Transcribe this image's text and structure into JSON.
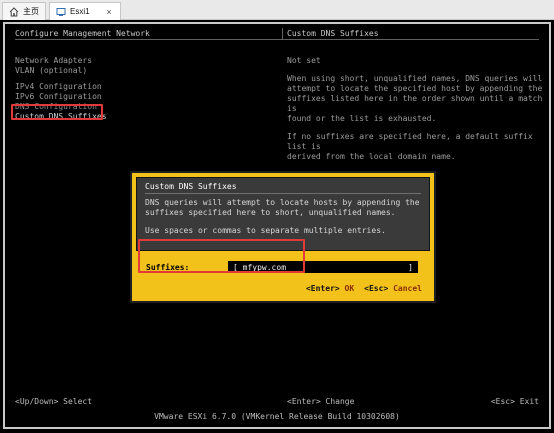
{
  "tabs": [
    {
      "label": "主页",
      "icon": "home-icon",
      "active": false
    },
    {
      "label": "Esxi1",
      "icon": "vm-console-icon",
      "active": true,
      "close": "×"
    }
  ],
  "console": {
    "left_header": "Configure Management Network",
    "right_header": "Custom DNS Suffixes",
    "menu_items": [
      "Network Adapters",
      "VLAN (optional)",
      "",
      "IPv4 Configuration",
      "IPv6 Configuration",
      "DNS Configuration",
      "Custom DNS Suffixes"
    ],
    "right_description": {
      "line1": "Not set",
      "para1": [
        "When using short, unqualified names, DNS queries will",
        "attempt to locate the specified host by appending the",
        "suffixes listed here in the order shown until a match is",
        "found or the list is exhausted."
      ],
      "para2": [
        "If no suffixes are specified here, a default suffix list is",
        "derived from the local domain name."
      ]
    },
    "dialog": {
      "title": "Custom DNS Suffixes",
      "text1": [
        "DNS queries will attempt to locate hosts by appending the",
        "suffixes specified here to short, unqualified names."
      ],
      "text2": [
        "Use spaces or commas to separate multiple entries."
      ],
      "field_label": "Suffixes:",
      "field_value": "mfypw.com",
      "enter_key": "<Enter>",
      "enter_label": "OK",
      "esc_key": "<Esc>",
      "esc_label": "Cancel"
    },
    "footer": {
      "left": "<Up/Down> Select",
      "center": "<Enter> Change",
      "right": "<Esc> Exit"
    },
    "status_line": "VMware ESXi 6.7.0 (VMKernel Release Build 10302608)"
  },
  "colors": {
    "console_bg": "#000000",
    "dialog_yellow": "#f2c21b",
    "highlight_red": "#e23a3a"
  }
}
